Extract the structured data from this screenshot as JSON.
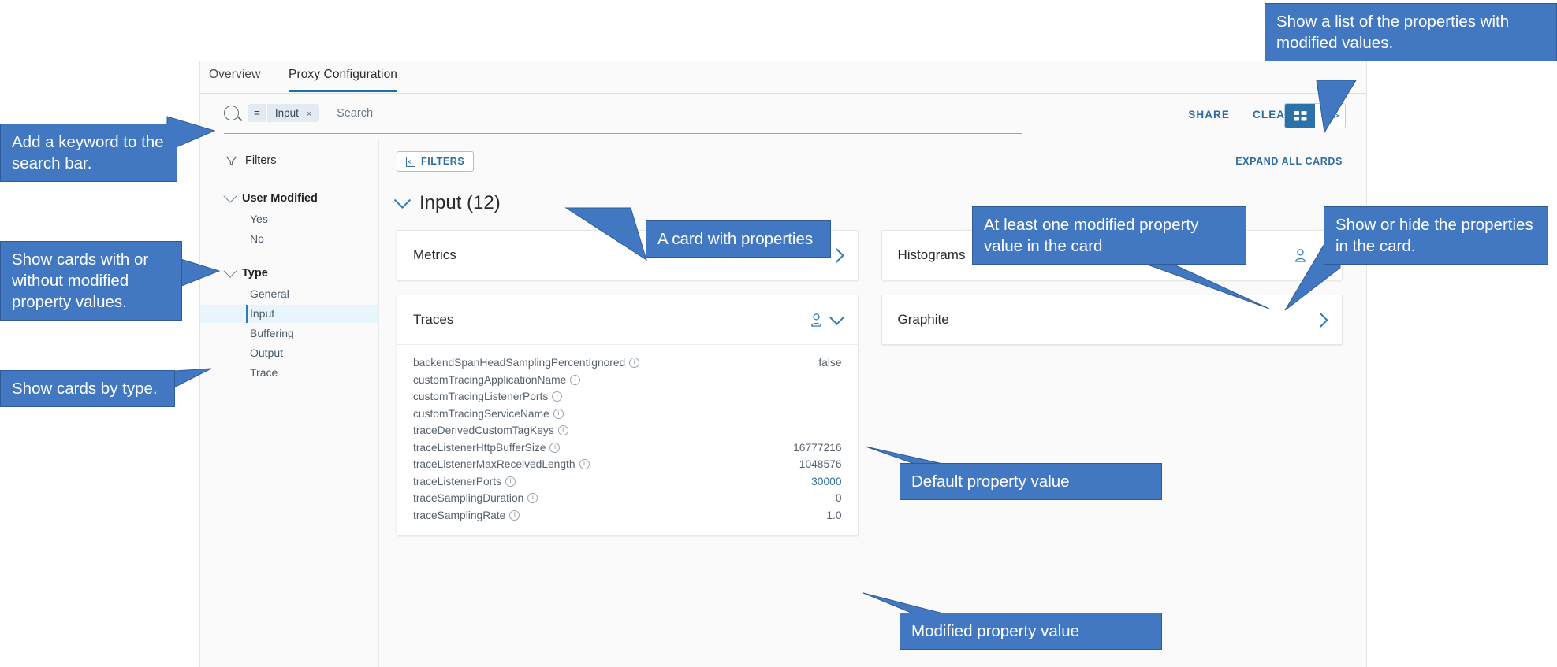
{
  "colors": {
    "callout_fill": "#4278c2",
    "callout_border": "#2f5b96",
    "accent": "#2e6da4",
    "tab_underline": "#1a6fa8",
    "selected_filter_bg": "#e8f5fd",
    "toggle_active": "#2a72a8"
  },
  "tabs": [
    {
      "label": "Overview",
      "active": false
    },
    {
      "label": "Proxy Configuration",
      "active": true
    }
  ],
  "search": {
    "chip_operator": "=",
    "chip_value": "Input",
    "chip_remove": "×",
    "placeholder": "Search",
    "share_label": "SHARE",
    "clear_label": "CLEAR",
    "view_grid_icon": "grid-view-icon",
    "view_code_icon": "code-view-icon",
    "view_code_glyph": "</>"
  },
  "sidebar": {
    "title": "Filters",
    "icon": "funnel-icon",
    "groups": [
      {
        "title": "User Modified",
        "options": [
          {
            "label": "Yes",
            "selected": false
          },
          {
            "label": "No",
            "selected": false
          }
        ]
      },
      {
        "title": "Type",
        "options": [
          {
            "label": "General",
            "selected": false
          },
          {
            "label": "Input",
            "selected": true
          },
          {
            "label": "Buffering",
            "selected": false
          },
          {
            "label": "Output",
            "selected": false
          },
          {
            "label": "Trace",
            "selected": false
          }
        ]
      }
    ]
  },
  "main": {
    "filters_button": "FILTERS",
    "expand_all": "EXPAND ALL CARDS",
    "section_title": "Input (12)",
    "cards": [
      {
        "title": "Metrics",
        "modified": false,
        "expanded": false,
        "properties": []
      },
      {
        "title": "Histograms",
        "modified": true,
        "expanded": false,
        "properties": []
      },
      {
        "title": "Traces",
        "modified": true,
        "expanded": true,
        "properties": [
          {
            "name": "backendSpanHeadSamplingPercentIgnored",
            "value": "false",
            "modified": false
          },
          {
            "name": "customTracingApplicationName",
            "value": "",
            "modified": false
          },
          {
            "name": "customTracingListenerPorts",
            "value": "",
            "modified": false
          },
          {
            "name": "customTracingServiceName",
            "value": "",
            "modified": false
          },
          {
            "name": "traceDerivedCustomTagKeys",
            "value": "",
            "modified": false
          },
          {
            "name": "traceListenerHttpBufferSize",
            "value": "16777216",
            "modified": false
          },
          {
            "name": "traceListenerMaxReceivedLength",
            "value": "1048576",
            "modified": false
          },
          {
            "name": "traceListenerPorts",
            "value": "30000",
            "modified": true
          },
          {
            "name": "traceSamplingDuration",
            "value": "0",
            "modified": false
          },
          {
            "name": "traceSamplingRate",
            "value": "1.0",
            "modified": false
          }
        ]
      },
      {
        "title": "Graphite",
        "modified": false,
        "expanded": false,
        "properties": []
      }
    ]
  },
  "callouts": [
    {
      "id": "add-keyword",
      "text": "Add a keyword to the search bar."
    },
    {
      "id": "modified-filter",
      "text": "Show cards with or without modified property values."
    },
    {
      "id": "type-filter",
      "text": "Show cards by type."
    },
    {
      "id": "card-properties",
      "text": "A card with properties"
    },
    {
      "id": "modified-in-card",
      "text": "At least one modified property value in the card"
    },
    {
      "id": "show-hide",
      "text": "Show or hide the properties in the card."
    },
    {
      "id": "modified-list",
      "text": "Show a list of the properties with modified values."
    },
    {
      "id": "default-value",
      "text": "Default property value"
    },
    {
      "id": "modified-value",
      "text": "Modified property value"
    }
  ]
}
